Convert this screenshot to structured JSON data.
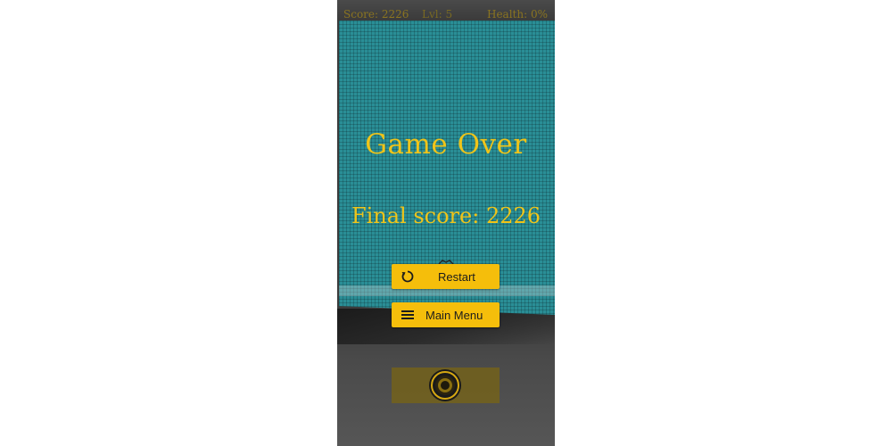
{
  "hud": {
    "score": "Score: 2226",
    "level": "Lvl: 5",
    "health": "Health: 0%"
  },
  "overlay": {
    "title": "Game Over",
    "final_score": "Final score: 2226"
  },
  "buttons": {
    "restart_label": "Restart",
    "restart_icon": "restart-icon",
    "main_menu_label": "Main Menu",
    "main_menu_icon": "menu-icon"
  },
  "controls": {
    "joystick_icon": "joystick-icon"
  },
  "colors": {
    "accent": "#f5be0b",
    "text_accent": "#f0c419",
    "board": "#2a8e96",
    "hud_text": "#8a7420"
  }
}
